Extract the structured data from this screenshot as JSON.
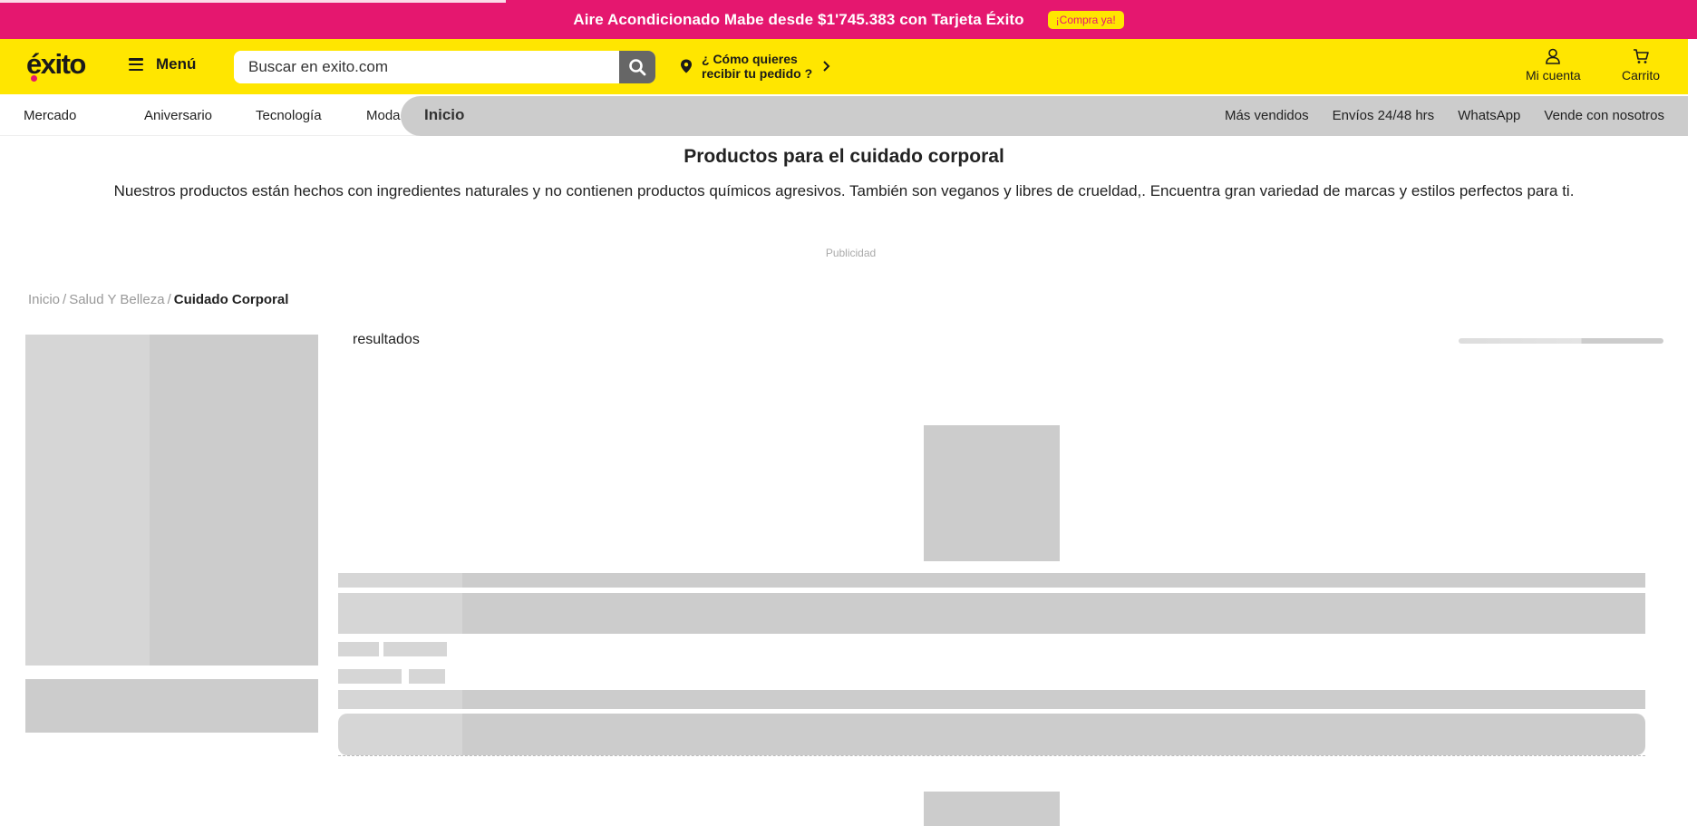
{
  "promo": {
    "text": "Aire Acondicionado Mabe desde $1'745.383 con Tarjeta Éxito",
    "cta": "¡Compra ya!"
  },
  "header": {
    "logo": "éxito",
    "menu_label": "Menú",
    "search_placeholder": "Buscar en exito.com",
    "delivery_line1": "¿ Cómo quieres",
    "delivery_line2": "recibir tu pedido ?",
    "account_label": "Mi cuenta",
    "cart_label": "Carrito"
  },
  "nav": {
    "left_items": [
      "Mercado",
      "Aniversario",
      "Tecnología",
      "Moda"
    ],
    "active": "Inicio",
    "right_items": [
      "Más vendidos",
      "Envíos 24/48 hrs",
      "WhatsApp",
      "Vende con nosotros"
    ]
  },
  "content": {
    "title": "Productos para el cuidado corporal",
    "description": "Nuestros productos están hechos con ingredientes naturales y no contienen productos químicos agresivos. También son veganos y libres de crueldad,. Encuentra gran variedad de marcas y estilos perfectos para ti.",
    "ad_label": "Publicidad",
    "results_label": "resultados"
  },
  "breadcrumb": {
    "items": [
      "Inicio",
      "Salud Y Belleza"
    ],
    "current": "Cuidado Corporal",
    "separator": "/"
  },
  "colors": {
    "promo_bg": "#e5176f",
    "header_bg": "#ffe600",
    "skeleton": "#cccccc",
    "skeleton_light": "#d6d6d6"
  },
  "icons": {
    "menu": "hamburger-icon",
    "search": "search-icon",
    "location": "location-pin-icon",
    "chevron": "chevron-right-icon",
    "account": "user-icon",
    "cart": "cart-icon"
  }
}
